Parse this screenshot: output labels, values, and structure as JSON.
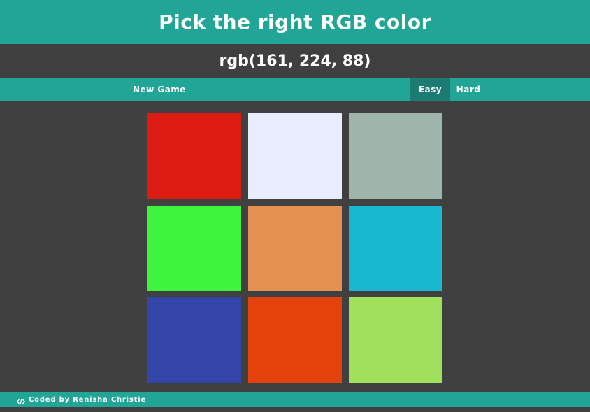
{
  "header": {
    "title": "Pick the right RGB color"
  },
  "target": {
    "rgb_text": "rgb(161, 224, 88)"
  },
  "controls": {
    "new_game_label": "New Game",
    "easy_label": "Easy",
    "hard_label": "Hard",
    "selected_mode": "Easy"
  },
  "colors": {
    "teal": "#21a597",
    "dark_teal": "#1c7b72",
    "background": "#404040"
  },
  "squares": [
    {
      "color": "#dc1c13"
    },
    {
      "color": "#eaedff"
    },
    {
      "color": "#9db5aa"
    },
    {
      "color": "#3ff43d"
    },
    {
      "color": "#e29150"
    },
    {
      "color": "#18b8d1"
    },
    {
      "color": "#3546aa"
    },
    {
      "color": "#e5410b"
    },
    {
      "color": "#a1e05b"
    }
  ],
  "footer": {
    "icon": "code-icon",
    "credit": "Coded by Renisha Christie"
  }
}
